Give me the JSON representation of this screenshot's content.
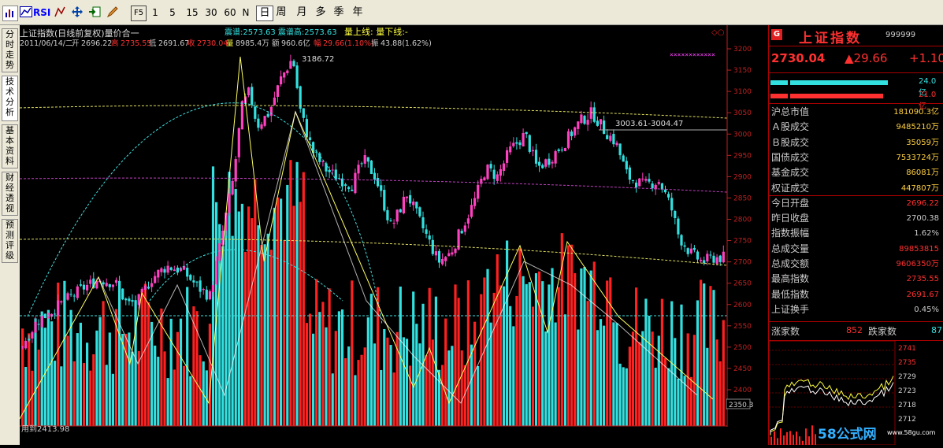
{
  "toolbar": {
    "rsi": "RSI",
    "f5": "F5",
    "periods": [
      "1",
      "5",
      "15",
      "30",
      "60",
      "N",
      "日",
      "周",
      "月",
      "多",
      "季",
      "年"
    ]
  },
  "side_tabs": [
    "分时走势",
    "技术分析",
    "基本资料",
    "财经透视",
    "预测评级"
  ],
  "chart_header": {
    "title": "上证指数(日线前复权)量价合一",
    "line2": "震谱:2573.63  震谱高:2573.63",
    "line3": "量上线:  量下线:-",
    "date": "2011/06/14/二",
    "open_label": "开",
    "open": "2696.22",
    "high_label": "高",
    "high": "2735.55",
    "low_label": "低",
    "low": "2691.67",
    "close_label": "收",
    "close": "2730.04",
    "vol_label": "量",
    "vol": "8985.4万",
    "amt_label": "额",
    "amt": "960.6亿",
    "chg_label": "幅",
    "chg": "29.66(1.10%)",
    "amp_label": "振",
    "amp": "43.88(1.62%)"
  },
  "annotations": {
    "peak": "3186.72",
    "range": "3003.61-3004.47",
    "bottom_value": "2350.3",
    "bottom_text": "用到2413.98"
  },
  "y_axis": [
    "3200",
    "3150",
    "3100",
    "3050",
    "3000",
    "2950",
    "2900",
    "2850",
    "2800",
    "2750",
    "2700",
    "2650",
    "2600",
    "2550",
    "2500",
    "2450",
    "2400"
  ],
  "colors": {
    "up": "#ff2020",
    "down": "#33e0e0",
    "grid": "#800000",
    "axis": "#c02020"
  },
  "right_panel": {
    "badge": "G",
    "name": "上证指数",
    "code": "999999",
    "price": "2730.04",
    "change": "▲29.66",
    "change2": "+1.10",
    "bar1_val": "24.0亿",
    "bar2_val": "21.0亿",
    "rows": [
      {
        "label": "沪总市值",
        "value": "181090.3亿"
      },
      {
        "label": "Ａ股成交",
        "value": "9485210万"
      },
      {
        "label": "Ｂ股成交",
        "value": "35059万"
      },
      {
        "label": "国债成交",
        "value": "7533724万"
      },
      {
        "label": "基金成交",
        "value": "86081万"
      },
      {
        "label": "权证成交",
        "value": "447807万"
      },
      {
        "label": "今日开盘",
        "value": "2696.22"
      },
      {
        "label": "昨日收盘",
        "value": "2700.38"
      },
      {
        "label": "指数振幅",
        "value": "1.62%"
      },
      {
        "label": "总成交量",
        "value": "89853815"
      },
      {
        "label": "总成交额",
        "value": "9606350万"
      },
      {
        "label": "最高指数",
        "value": "2735.55"
      },
      {
        "label": "最低指数",
        "value": "2691.67"
      },
      {
        "label": "上证换手",
        "value": "0.45%"
      }
    ],
    "rise_label": "涨家数",
    "rise_count": "852",
    "fall_label": "跌家数",
    "fall_count": "87",
    "mini_axis": [
      "2741",
      "2735",
      "2729",
      "2723",
      "2718",
      "2712"
    ],
    "watermark": "58公式网",
    "watermark_url": "www.58gu.com"
  }
}
